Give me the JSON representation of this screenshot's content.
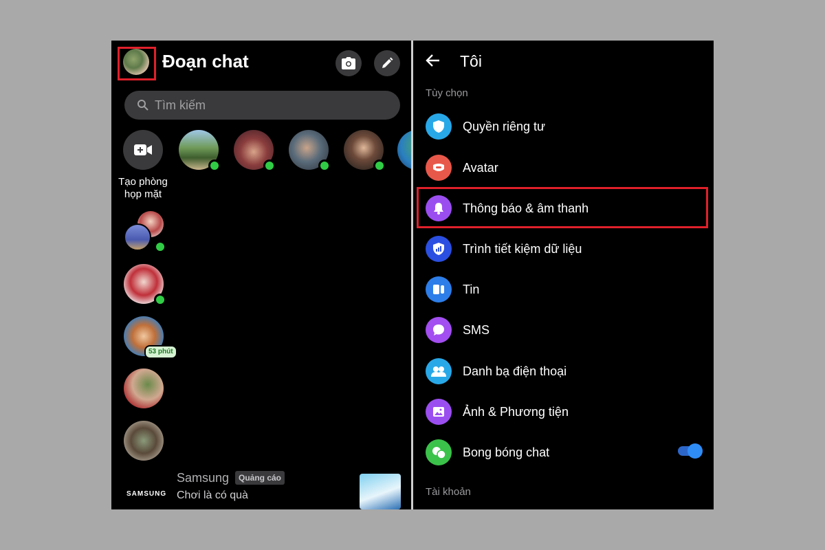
{
  "left": {
    "title": "Đoạn chat",
    "search_placeholder": "Tìm kiếm",
    "create_room_label_line1": "Tạo phòng",
    "create_room_label_line2": "họp mặt",
    "active_time_badge": "53 phút",
    "ad": {
      "logo": "SAMSUNG",
      "name": "Samsung",
      "tag": "Quảng cáo",
      "subtitle": "Chơi là có quà"
    }
  },
  "right": {
    "title": "Tôi",
    "section_options": "Tùy chọn",
    "section_account": "Tài khoản",
    "items": [
      {
        "label": "Quyền riêng tư",
        "icon": "shield-icon",
        "color": "#29a8e8"
      },
      {
        "label": "Avatar",
        "icon": "avatar-icon",
        "color": "#e8584a"
      },
      {
        "label": "Thông báo & âm thanh",
        "icon": "bell-icon",
        "color": "#9b4ef0"
      },
      {
        "label": "Trình tiết kiệm dữ liệu",
        "icon": "data-saver-icon",
        "color": "#2b4fe0"
      },
      {
        "label": "Tin",
        "icon": "stories-icon",
        "color": "#2d7ee8"
      },
      {
        "label": "SMS",
        "icon": "chat-bubble-icon",
        "color": "#a24ef0"
      },
      {
        "label": "Danh bạ điện thoại",
        "icon": "contacts-icon",
        "color": "#29a8e8"
      },
      {
        "label": "Ảnh & Phương tiện",
        "icon": "photo-icon",
        "color": "#9b4ef0"
      },
      {
        "label": "Bong bóng chat",
        "icon": "chat-heads-icon",
        "color": "#3bc24a"
      }
    ],
    "chat_heads_toggle": "on"
  },
  "colors": {
    "highlight": "#e0202a",
    "online": "#31cc46",
    "toggle": "#2f8cf5"
  }
}
